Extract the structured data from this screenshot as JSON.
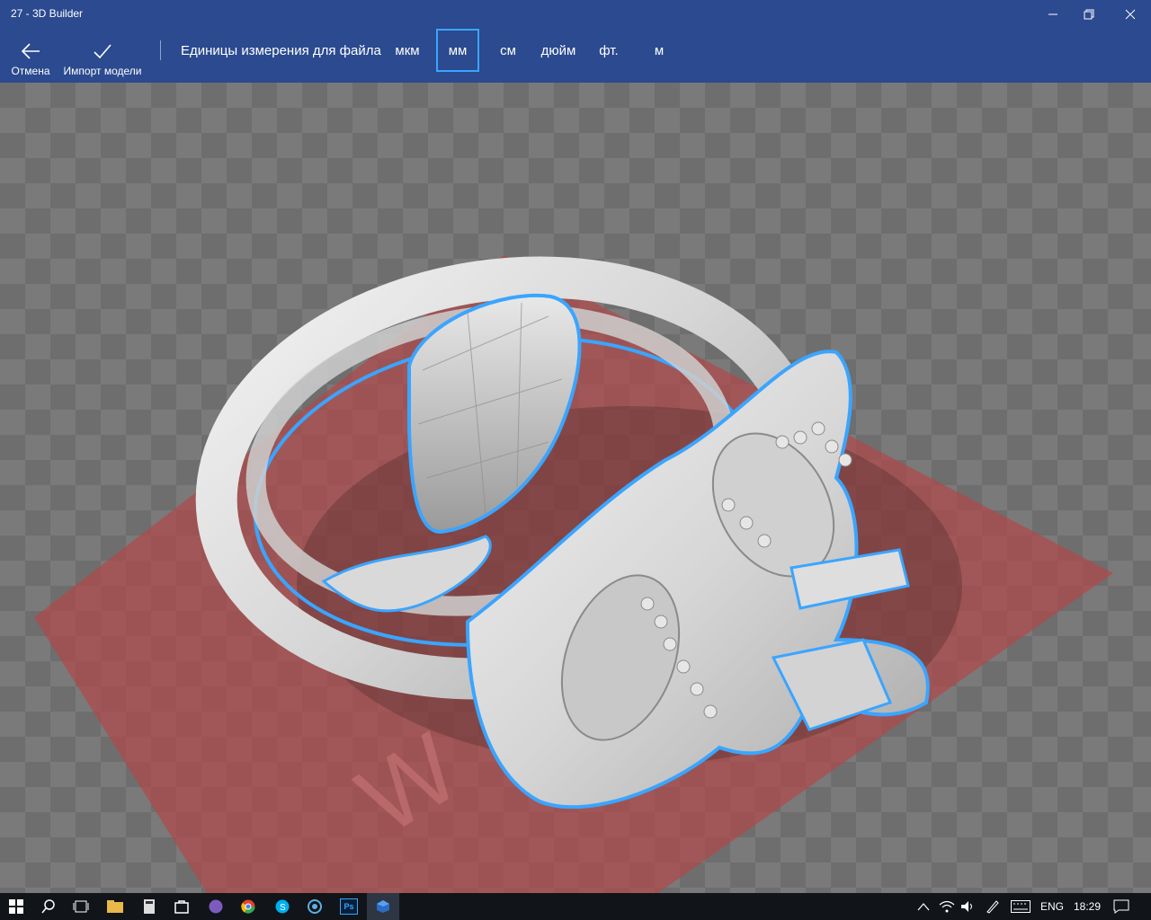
{
  "window": {
    "title": "27 - 3D Builder"
  },
  "commandbar": {
    "cancel_label": "Отмена",
    "import_label": "Импорт модели",
    "units_label": "Единицы измерения для файла",
    "units": [
      {
        "label": "мкм",
        "selected": false
      },
      {
        "label": "мм",
        "selected": true
      },
      {
        "label": "см",
        "selected": false
      },
      {
        "label": "дюйм",
        "selected": false
      },
      {
        "label": "фт.",
        "selected": false
      },
      {
        "label": "м",
        "selected": false
      }
    ]
  },
  "viewport": {
    "model": "ring",
    "selection_color": "#3aa5ff",
    "build_plate_color": "#b04a4a"
  },
  "taskbar": {
    "icons": [
      "windows-start-icon",
      "search-icon",
      "task-view-icon",
      "file-explorer-icon",
      "calculator-icon",
      "store-icon",
      "viber-icon",
      "chrome-icon",
      "skype-icon",
      "app-icon",
      "photoshop-icon",
      "3d-builder-icon"
    ],
    "photoshop_text": "Ps",
    "lang": "ENG",
    "time": "18:29"
  },
  "colors": {
    "accent": "#2b4a8f",
    "selection": "#3aa5ff"
  }
}
